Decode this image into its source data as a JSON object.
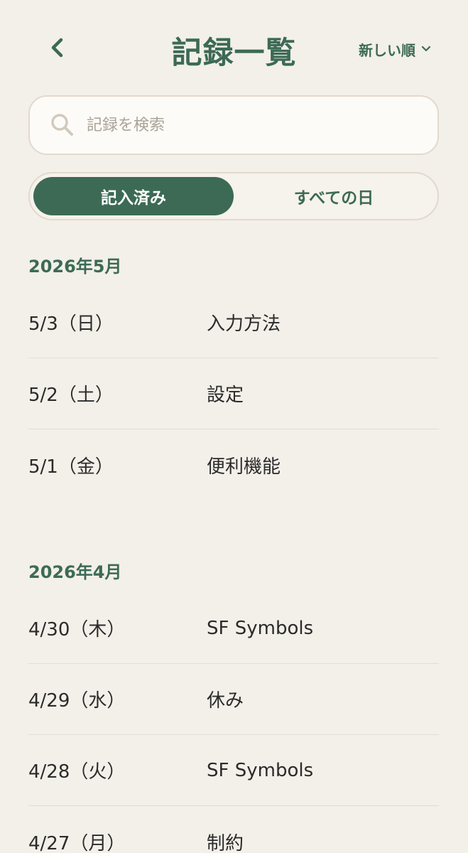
{
  "header": {
    "title": "記録一覧",
    "back_icon": "chevron-left-icon",
    "sort_label": "新しい順",
    "sort_icon": "chevron-down-icon"
  },
  "search": {
    "placeholder": "記録を検索",
    "value": "",
    "icon": "search-icon"
  },
  "segment": {
    "tabs": [
      {
        "label": "記入済み",
        "active": true
      },
      {
        "label": "すべての日",
        "active": false
      }
    ]
  },
  "groups": [
    {
      "month": "2026年5月",
      "entries": [
        {
          "date": "5/3（日）",
          "title": "入力方法"
        },
        {
          "date": "5/2（土）",
          "title": "設定"
        },
        {
          "date": "5/1（金）",
          "title": "便利機能"
        }
      ]
    },
    {
      "month": "2026年4月",
      "entries": [
        {
          "date": "4/30（木）",
          "title": "SF Symbols"
        },
        {
          "date": "4/29（水）",
          "title": "休み"
        },
        {
          "date": "4/28（火）",
          "title": "SF Symbols"
        },
        {
          "date": "4/27（月）",
          "title": "制約"
        }
      ]
    }
  ],
  "colors": {
    "background": "#f3efe9",
    "accent": "#3c6a55",
    "text": "#2b2b2b",
    "placeholder": "#aaa397",
    "border": "#e2d9cd"
  }
}
